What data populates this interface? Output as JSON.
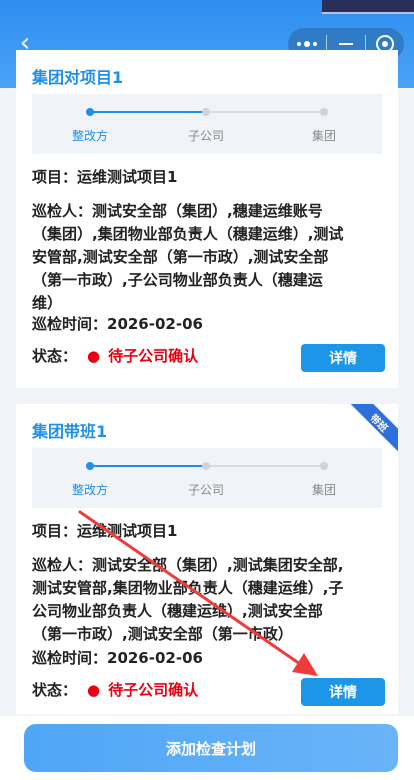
{
  "header": {
    "back_icon": "chevron-left-icon",
    "capsule": {
      "more_icon": "more-dots-icon",
      "minimize_icon": "minus-icon",
      "close_icon": "target-icon"
    }
  },
  "colors": {
    "accent": "#1f8fe8",
    "status": "#e60012",
    "button": "#1e96e8",
    "ribbon": "#2e6fe0"
  },
  "cards": [
    {
      "title": "集团对项目1",
      "steps": [
        "整改方",
        "子公司",
        "集团"
      ],
      "project": "项目：运维测试项目1",
      "inspectors": [
        "巡检人：测试安全部（集团）,穗建运维账号",
        "（集团）,集团物业部负责人（穗建运维）,测试",
        "安管部,测试安全部（第一市政）,测试安全部",
        "（第一市政）,子公司物业部负责人（穗建运",
        "维）"
      ],
      "time": "巡检时间：2026-02-06",
      "status_label": "状态：",
      "status_dot": "●",
      "status_value": "待子公司确认",
      "detail": "详情"
    },
    {
      "title": "集团带班1",
      "ribbon": "带班",
      "steps": [
        "整改方",
        "子公司",
        "集团"
      ],
      "project": "项目：运维测试项目1",
      "inspectors": [
        "巡检人：测试安全部（集团）,测试集团安全部,",
        "测试安管部,集团物业部负责人（穗建运维）,子",
        "公司物业部负责人（穗建运维）,测试安全部",
        "（第一市政）,测试安全部（第一市政）"
      ],
      "time": "巡检时间：2026-02-06",
      "status_label": "状态：",
      "status_dot": "●",
      "status_value": "待子公司确认",
      "detail": "详情"
    }
  ],
  "footer": {
    "add_label": "添加检查计划"
  }
}
